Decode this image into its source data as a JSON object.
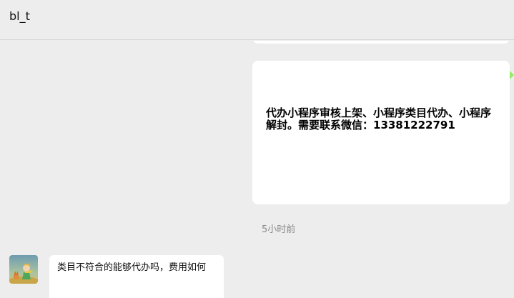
{
  "header": {
    "title": "bl_t"
  },
  "chat": {
    "messages": [
      {
        "kind": "image",
        "side": "right",
        "text": "代办小程序审核上架、小程序类目代办、小程序解封。需要联系微信：13381222791"
      },
      {
        "kind": "timestamp",
        "text": "5小时前"
      },
      {
        "kind": "text",
        "side": "left",
        "avatar_icon": "little-prince-avatar-icon",
        "text": "类目不符合的能够代办吗，费用如何"
      }
    ]
  },
  "colors": {
    "background": "#ededed",
    "bubble_incoming": "#ffffff",
    "bubble_outgoing_marker": "#95ec69",
    "timestamp": "#8a8a8a"
  }
}
